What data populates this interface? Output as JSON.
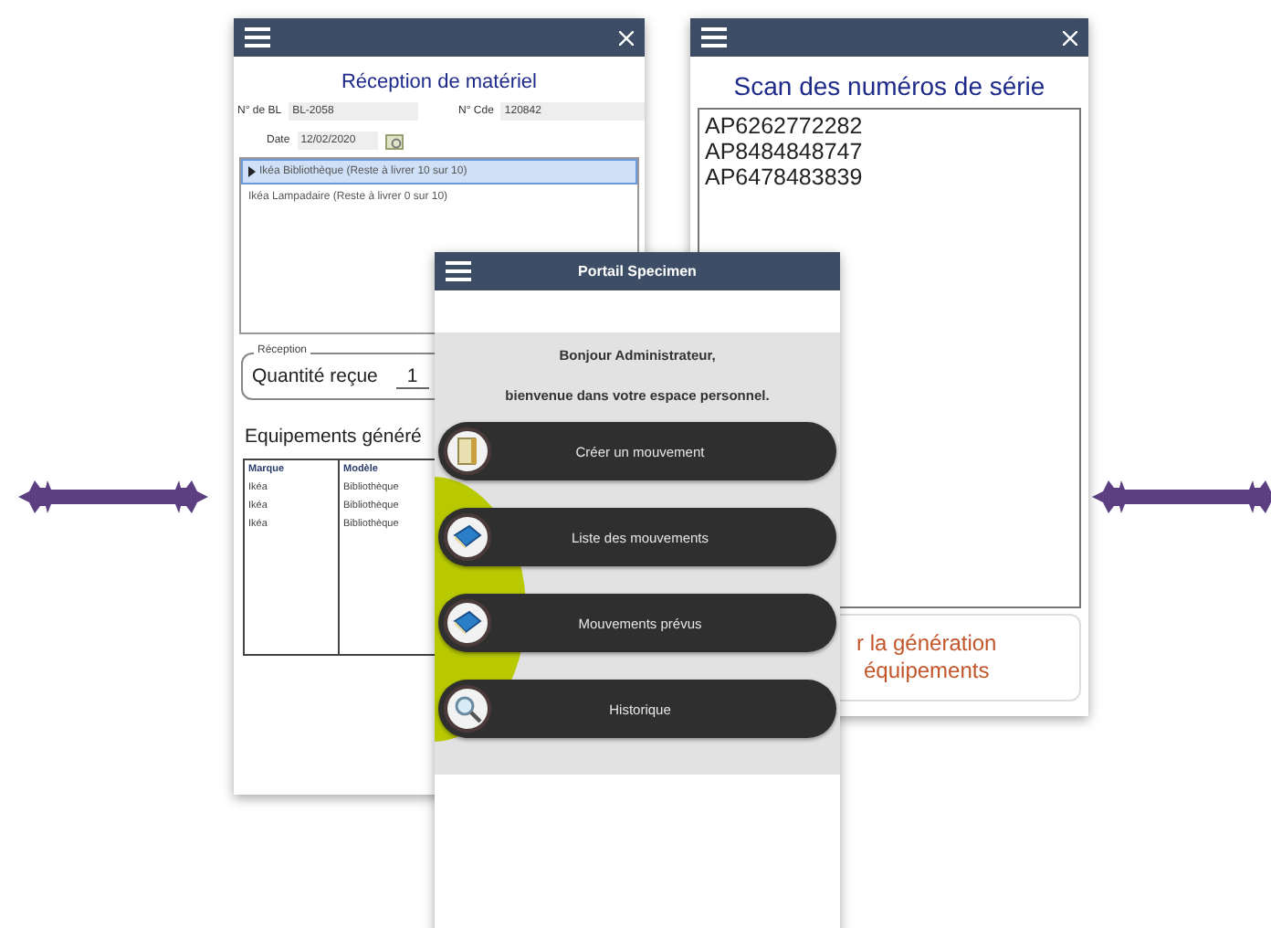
{
  "reception_screen": {
    "title": "Réception de matériel",
    "bl_label": "N° de BL",
    "bl_value": "BL-2058",
    "cde_label": "N° Cde",
    "cde_value": "120842",
    "date_label": "Date",
    "date_value": "12/02/2020",
    "items": [
      {
        "label": "Ikéa Bibliothèque (Reste à livrer 10 sur 10)",
        "selected": true
      },
      {
        "label": "Ikéa Lampadaire (Reste à livrer 0 sur 10)",
        "selected": false
      }
    ],
    "reception_legend": "Réception",
    "quantity_label": "Quantité reçue",
    "quantity_value": "1",
    "equipment_title": "Equipements généré",
    "table": {
      "columns": [
        "Marque",
        "Modèle"
      ],
      "rows": [
        [
          "Ikéa",
          "Bibliothèque"
        ],
        [
          "Ikéa",
          "Bibliothèque"
        ],
        [
          "Ikéa",
          "Bibliothèque"
        ]
      ]
    }
  },
  "scan_screen": {
    "title": "Scan des numéros de série",
    "serials": [
      "AP6262772282",
      "AP8484848747",
      "AP6478483839"
    ],
    "button_lines": [
      "r la génération",
      "équipements"
    ]
  },
  "portal_screen": {
    "title": "Portail Specimen",
    "greeting": "Bonjour Administrateur,",
    "welcome": "bienvenue dans votre espace personnel.",
    "menu": [
      {
        "label": "Créer un mouvement",
        "kind": "document"
      },
      {
        "label": "Liste des mouvements",
        "kind": "book"
      },
      {
        "label": "Mouvements prévus",
        "kind": "book"
      },
      {
        "label": "Historique",
        "kind": "search"
      }
    ]
  }
}
